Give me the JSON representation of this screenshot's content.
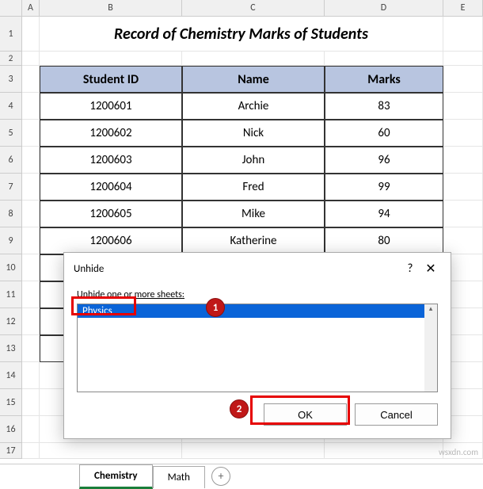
{
  "columns": [
    "A",
    "B",
    "C",
    "D",
    "E"
  ],
  "rows": [
    "1",
    "2",
    "3",
    "4",
    "5",
    "6",
    "7",
    "8",
    "9",
    "10",
    "11",
    "12",
    "13",
    "14",
    "15",
    "16",
    "17"
  ],
  "title": "Record of Chemistry Marks of Students",
  "table": {
    "headers": [
      "Student ID",
      "Name",
      "Marks"
    ],
    "rows": [
      [
        "1200601",
        "Archie",
        "83"
      ],
      [
        "1200602",
        "Nick",
        "60"
      ],
      [
        "1200603",
        "John",
        "96"
      ],
      [
        "1200604",
        "Fred",
        "99"
      ],
      [
        "1200605",
        "Mike",
        "94"
      ],
      [
        "1200606",
        "Katherine",
        "80"
      ]
    ]
  },
  "tabs": {
    "items": [
      "Chemistry",
      "Math"
    ],
    "active": "Chemistry"
  },
  "dialog": {
    "title": "Unhide",
    "label_pre": "U",
    "label_rest": "nhide one or more sheets:",
    "items": [
      "Physics"
    ],
    "ok": "OK",
    "cancel": "Cancel",
    "help": "?",
    "close": "✕"
  },
  "callouts": {
    "c1": "1",
    "c2": "2"
  },
  "watermark": "wsxdn.com"
}
